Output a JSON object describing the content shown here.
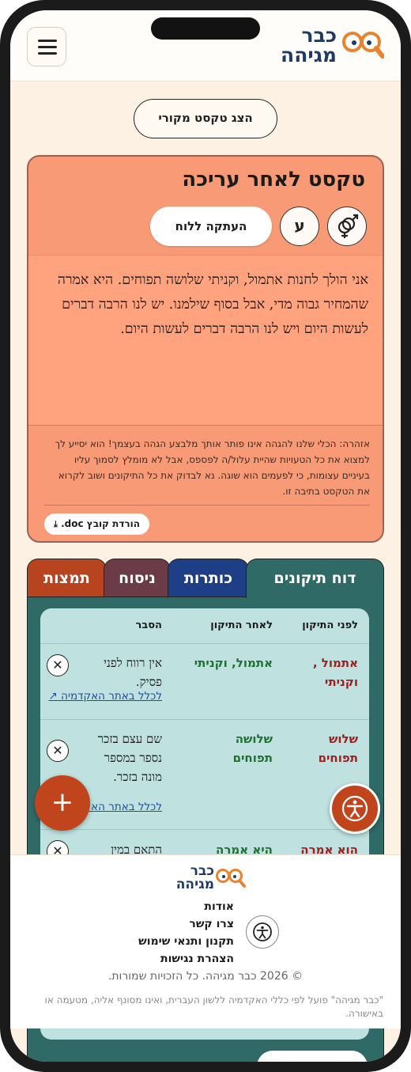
{
  "header": {
    "logo_line1": "כבר",
    "logo_line2": "מגיהה",
    "menu_icon": "hamburger-icon"
  },
  "show_original_label": "הצג טקסט מקורי",
  "edited_card": {
    "title": "טקסט לאחר עריכה",
    "copy_label": "העתקה ללוח",
    "gender_icon": "gender-symbol-icon",
    "letter_button": "ע",
    "body_text": "אני הולך לחנות אתמול, וקניתי שלושה תפוחים. היא אמרה שהמחיר גבוה מדי, אבל בסוף שילמנו. יש לנו הרבה דברים לעשות היום ויש לנו הרבה דברים לעשות היום.",
    "warning": "אזהרה: הכלי שלנו להגהה אינו פותר אותך מלבצע הגהה בעצמך! הוא יסייע לך למצוא את כל הטעויות שהיית עלול/ה לפספס, אבל לא מומלץ לסמוך עליו בעיניים עצומות, כי לפעמים הוא שוגה. נא לבדוק את כל התיקונים ושוב לקרוא את הטקסט בתיבה זו.",
    "download_label": "הורדת קובץ doc."
  },
  "tabs": [
    {
      "label": "דוח תיקונים",
      "color": "#2f6a66"
    },
    {
      "label": "כותרות",
      "color": "#1e3f86"
    },
    {
      "label": "ניסוח",
      "color": "#6b3b47"
    },
    {
      "label": "תמצות",
      "color": "#b7431f"
    }
  ],
  "table": {
    "headers": {
      "before": "לפני התיקון",
      "after": "לאחר התיקון",
      "explanation": "הסבר"
    },
    "rows": [
      {
        "before": "אתמול , וקניתי",
        "after": "אתמול, וקניתי",
        "explanation": "אין רווח לפני פסיק.",
        "link": "לכלל באתר האקדמיה ↗"
      },
      {
        "before": "שלוש תפוחים",
        "after": "שלושה תפוחים",
        "explanation": "שם עצם בזכר נספר במספר מונה בזכר.",
        "link": "לכלל באתר האקדמיה ↗"
      },
      {
        "before": "הוא אמרה",
        "after": "היא אמרה",
        "explanation": "התאם במין"
      }
    ]
  },
  "fab_label": "+",
  "footer": {
    "logo_line1": "כבר",
    "logo_line2": "מגיהה",
    "links": [
      "אודות",
      "צרו קשר",
      "תקנון ותנאי שימוש",
      "הצהרת נגישות"
    ],
    "copyright": "© 2026 כבר מגיהה. כל הזכויות שמורות.",
    "disclaimer": "\"כבר מגיהה\" פועל לפי כללי האקדמיה ללשון העברית, ואינו מסונף אליה, מטעמה או באישורה."
  },
  "colors": {
    "accent": "#c0451c",
    "card": "#f79a75",
    "teal": "#2f6a66",
    "navy": "#1f3a63"
  }
}
